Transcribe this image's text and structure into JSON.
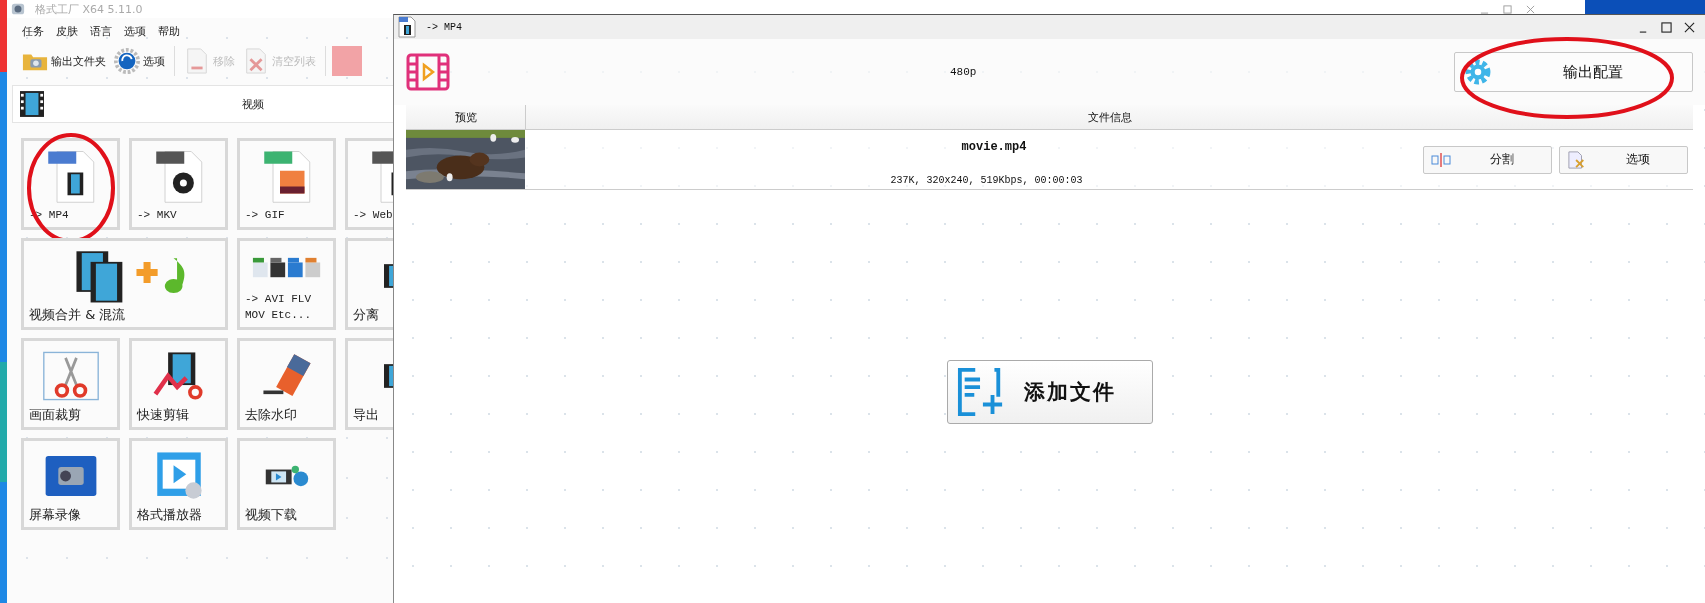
{
  "left_window": {
    "title": "格式工厂 X64 5.11.0",
    "menu": [
      "任务",
      "皮肤",
      "语言",
      "选项",
      "帮助"
    ],
    "toolbar": [
      {
        "label": "输出文件夹",
        "kind": "folder",
        "disabled": false
      },
      {
        "label": "选项",
        "kind": "gear",
        "disabled": false
      },
      {
        "label": "移除",
        "kind": "remove",
        "disabled": true
      },
      {
        "label": "清空列表",
        "kind": "clear",
        "disabled": true
      }
    ],
    "category": "视频",
    "tiles": [
      {
        "label": "-> MP4",
        "kind": "mp4",
        "circled": true
      },
      {
        "label": "-> MKV",
        "kind": "mkv",
        "circled": false
      },
      {
        "label": "-> GIF",
        "kind": "gif",
        "circled": false
      },
      {
        "label": "-> Web",
        "kind": "webm",
        "circled": false
      },
      {
        "label": "视频合并 & 混流",
        "kind": "merge",
        "circled": false
      },
      {
        "label": "-> AVI FLV MOV Etc...",
        "kind": "multi",
        "circled": false
      },
      {
        "label": "分离",
        "kind": "film",
        "circled": false
      },
      {
        "label": "画面裁剪",
        "kind": "crop",
        "circled": false
      },
      {
        "label": "快速剪辑",
        "kind": "cut",
        "circled": false
      },
      {
        "label": "去除水印",
        "kind": "logo",
        "circled": false
      },
      {
        "label": "导出",
        "kind": "film",
        "circled": false
      },
      {
        "label": "屏幕录像",
        "kind": "record",
        "circled": false
      },
      {
        "label": "格式播放器",
        "kind": "player",
        "circled": false
      },
      {
        "label": "视频下载",
        "kind": "download",
        "circled": false
      }
    ]
  },
  "right_window": {
    "title": "-> MP4",
    "quality": "480p",
    "output_button": {
      "label": "输出配置",
      "circled": true
    },
    "table": {
      "columns": [
        "预览",
        "文件信息"
      ],
      "rows": [
        {
          "name": "movie.mp4",
          "info": "237K, 320x240, 519Kbps, 00:00:03",
          "buttons": [
            {
              "label": "分割",
              "kind": "split"
            },
            {
              "label": "选项",
              "kind": "options"
            }
          ]
        }
      ]
    },
    "add_button": "添加文件"
  }
}
